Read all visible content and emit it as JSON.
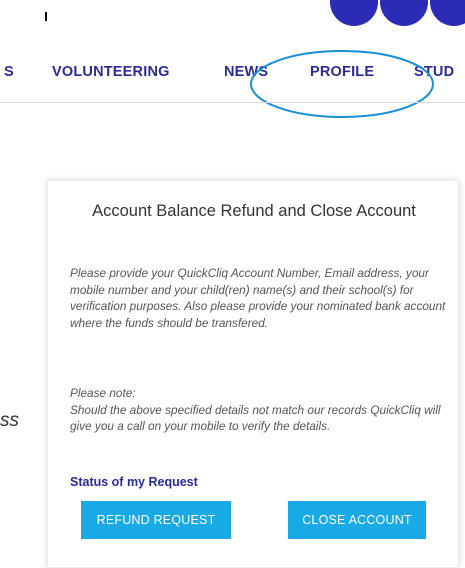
{
  "nav": {
    "items": [
      {
        "label": "S"
      },
      {
        "label": "VOLUNTEERING"
      },
      {
        "label": "NEWS"
      },
      {
        "label": "PROFILE"
      },
      {
        "label": "STUD"
      }
    ]
  },
  "card": {
    "title": "Account Balance Refund and Close Account",
    "body": "Please provide your QuickCliq Account Number, Email address, your mobile number and your child(ren) name(s) and their school(s) for verification purposes. Also please provide your nominated bank account where the funds should be transfered.",
    "note_label": "Please note:",
    "note_text": "Should the above specified details not match our records QuickCliq will give you a call on your mobile to verify the details.",
    "status_heading": "Status of my Request",
    "refund_button": "REFUND REQUEST",
    "close_button": "CLOSE ACCOUNT"
  },
  "left_clip_text": "ss",
  "colors": {
    "nav_text": "#2b2b96",
    "button_bg": "#19a9e5",
    "annotation": "#1a8fd6",
    "circle": "#2b2bb5"
  },
  "icons": [
    "logo-circles"
  ]
}
